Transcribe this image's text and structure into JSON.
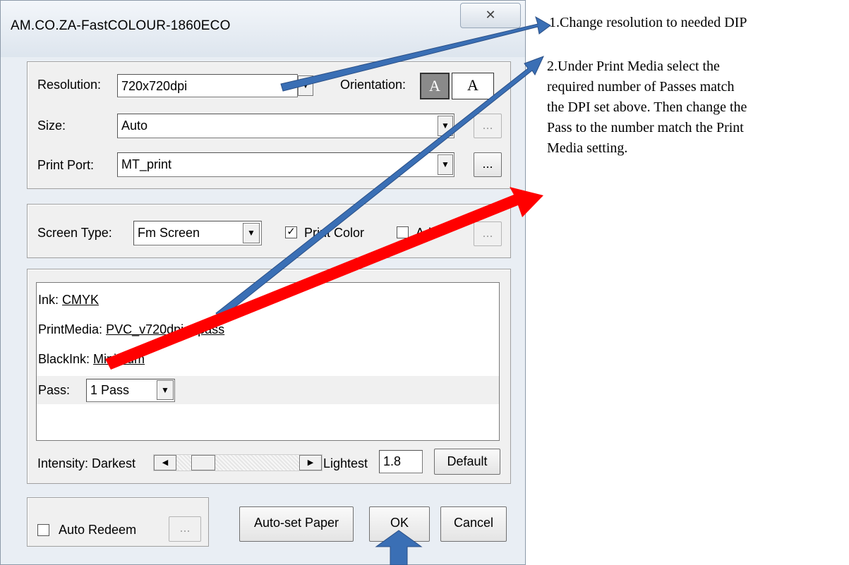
{
  "window": {
    "title": "AM.CO.ZA-FastCOLOUR-1860ECO",
    "close_glyph": "✕"
  },
  "settings": {
    "resolution_label": "Resolution:",
    "resolution_value": "720x720dpi",
    "orientation_label": "Orientation:",
    "size_label": "Size:",
    "size_value": "Auto",
    "port_label": "Print Port:",
    "port_value": "MT_print",
    "browse_label": "..."
  },
  "screen": {
    "type_label": "Screen Type:",
    "type_value": "Fm Screen",
    "print_color_label": "Print Color",
    "print_color_checked": true,
    "adjust_label": "Adj",
    "adjust_checked": false
  },
  "media": {
    "ink_label": "Ink:",
    "ink_value": "CMYK",
    "printmedia_label": "PrintMedia:",
    "printmedia_value": "PVC_v720dpi_4pass",
    "blackink_label": "BlackInk:",
    "blackink_value": "Minimum",
    "pass_label": "Pass:",
    "pass_value": "1 Pass"
  },
  "intensity": {
    "label": "Intensity: Darkest",
    "lightest_label": "Lightest",
    "value": "1.8",
    "level": 0.15,
    "default_label": "Default"
  },
  "footer": {
    "auto_redeem_label": "Auto Redeem",
    "auto_redeem_checked": false,
    "browse_label": "...",
    "autoset_label": "Auto-set Paper",
    "ok_label": "OK",
    "cancel_label": "Cancel"
  },
  "annotations": {
    "note1": "1.Change resolution to needed DIP",
    "note2_lines": [
      "2.Under Print Media select the",
      "required number of Passes match",
      "the DPI set above. Then change the",
      "Pass to the number match the Print",
      "Media setting."
    ],
    "blue_color": "#3a6fb5",
    "red_color": "#ff0000"
  }
}
